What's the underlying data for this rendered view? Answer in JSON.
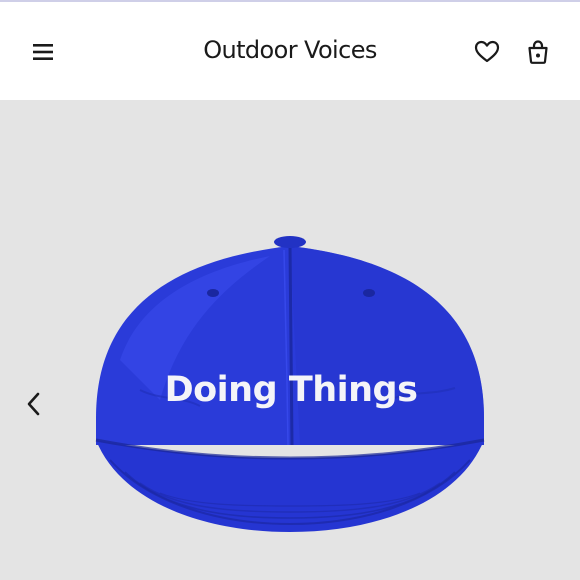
{
  "header": {
    "brand": "Outdoor Voices",
    "icons": [
      "menu-icon",
      "heart-icon",
      "bag-icon"
    ]
  },
  "gallery": {
    "product_embroidery": "Doing Things",
    "nav_icon": "chevron-left-icon",
    "colors": {
      "background": "#e4e4e4",
      "hat": "#2a3bd9",
      "embroidery": "#f4f4f8"
    }
  }
}
